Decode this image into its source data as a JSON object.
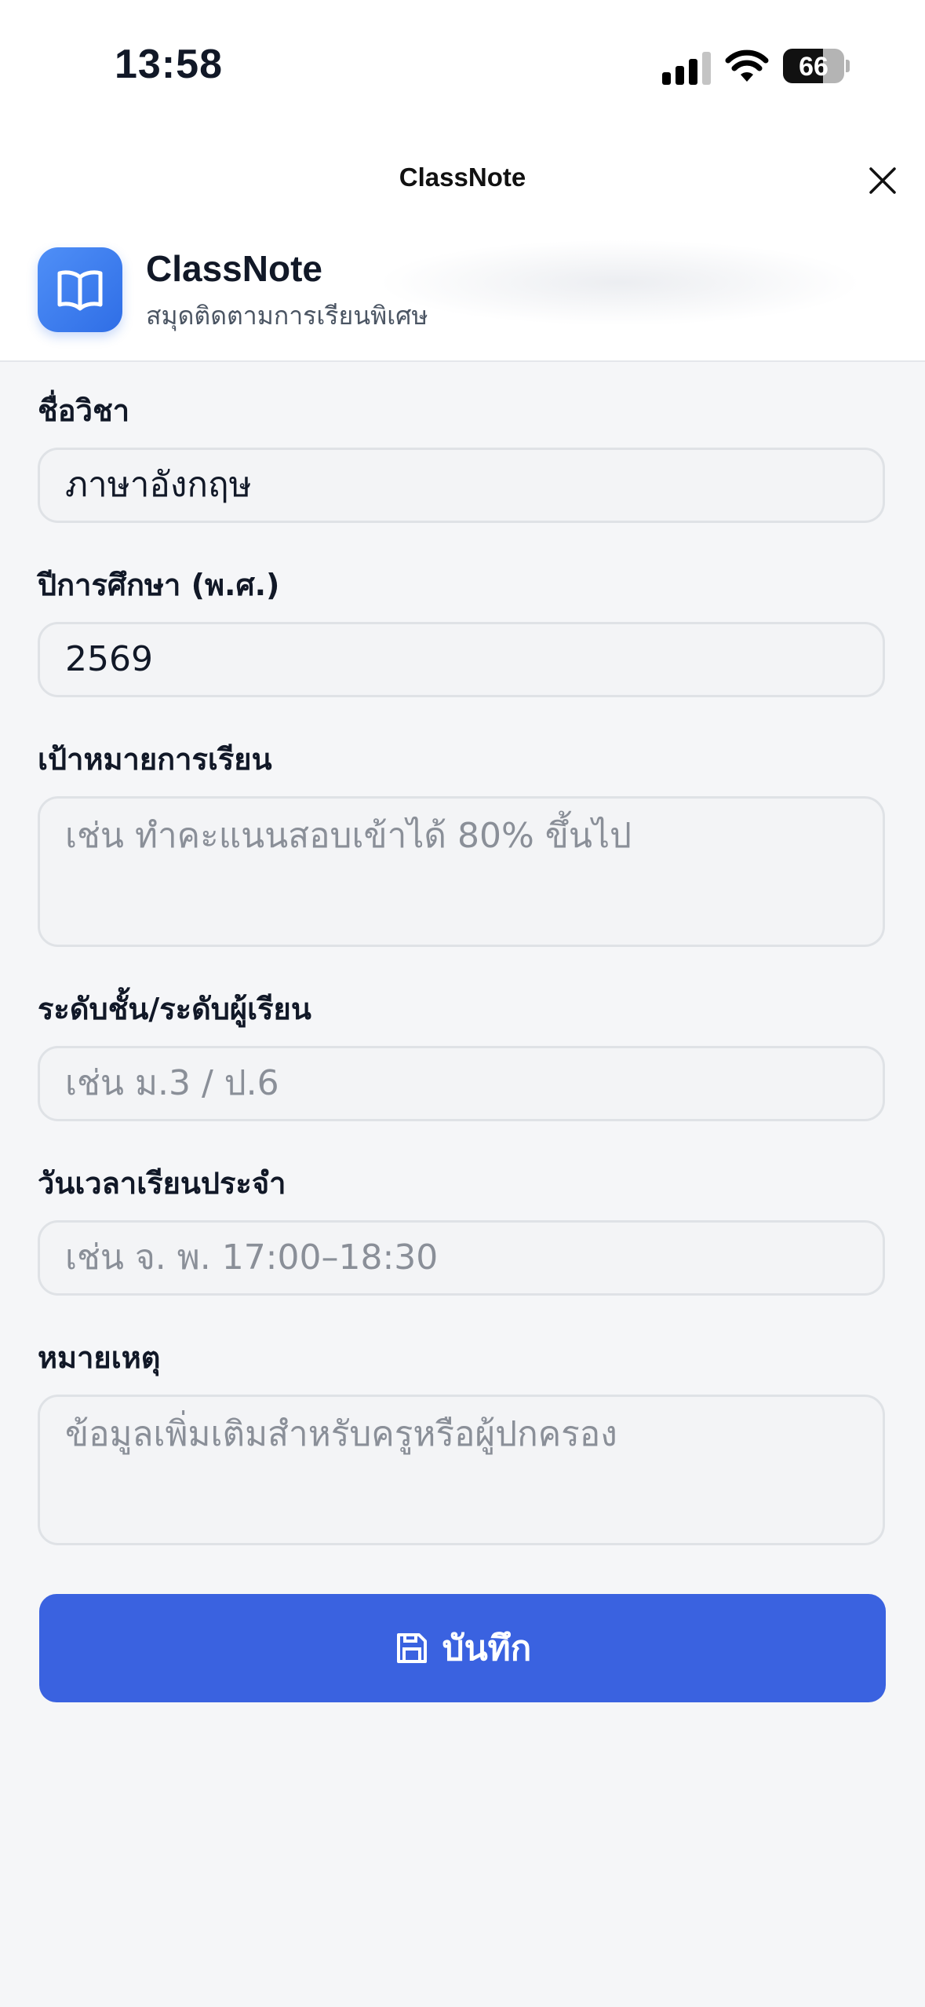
{
  "status_bar": {
    "time": "13:58",
    "battery": "66"
  },
  "sheet": {
    "title": "ClassNote"
  },
  "app": {
    "name": "ClassNote",
    "subtitle": "สมุดติดตามการเรียนพิเศษ",
    "icon": "open-book-icon",
    "accent_color": "#3a62e0"
  },
  "form": {
    "subject": {
      "label": "ชื่อวิชา",
      "value": "ภาษาอังกฤษ"
    },
    "academic_year": {
      "label": "ปีการศึกษา (พ.ศ.)",
      "value": "2569"
    },
    "goal": {
      "label": "เป้าหมายการเรียน",
      "placeholder": "เช่น ทำคะแนนสอบเข้าได้ 80% ขึ้นไป"
    },
    "level": {
      "label": "ระดับชั้น/ระดับผู้เรียน",
      "placeholder": "เช่น ม.3 / ป.6"
    },
    "schedule": {
      "label": "วันเวลาเรียนประจำ",
      "placeholder": "เช่น จ. พ. 17:00–18:30"
    },
    "notes": {
      "label": "หมายเหตุ",
      "placeholder": "ข้อมูลเพิ่มเติมสำหรับครูหรือผู้ปกครอง"
    },
    "save_label": "บันทึก"
  }
}
